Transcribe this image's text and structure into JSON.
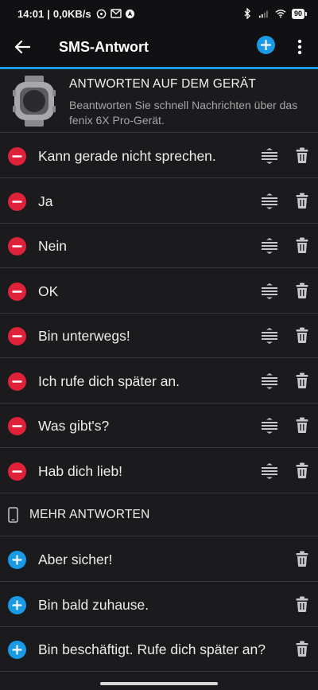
{
  "status_bar": {
    "time": "14:01",
    "network_speed": "0,0KB/s",
    "notification_icons": [
      "whatsapp-icon",
      "gmail-icon",
      "maps-icon"
    ],
    "system_icons": [
      "bluetooth-icon",
      "signal-icon",
      "wifi-icon"
    ],
    "battery": "90"
  },
  "app_bar": {
    "title": "SMS-Antwort",
    "accent_color": "#1a9ae6"
  },
  "device_section": {
    "title": "ANTWORTEN AUF DEM GERÄT",
    "subtitle": "Beantworten Sie schnell Nachrichten über das fenix 6X Pro-Gerät."
  },
  "device_replies": [
    {
      "text": "Kann gerade nicht sprechen."
    },
    {
      "text": "Ja"
    },
    {
      "text": "Nein"
    },
    {
      "text": "OK"
    },
    {
      "text": "Bin unterwegs!"
    },
    {
      "text": "Ich rufe dich später an."
    },
    {
      "text": "Was gibt's?"
    },
    {
      "text": "Hab dich lieb!"
    }
  ],
  "more_section": {
    "title": "MEHR ANTWORTEN"
  },
  "more_replies": [
    {
      "text": "Aber sicher!"
    },
    {
      "text": "Bin bald zuhause."
    },
    {
      "text": "Bin beschäftigt. Rufe dich später an?"
    }
  ],
  "colors": {
    "remove": "#e0213a",
    "add": "#1a9ae6",
    "background": "#1b1b1d"
  }
}
